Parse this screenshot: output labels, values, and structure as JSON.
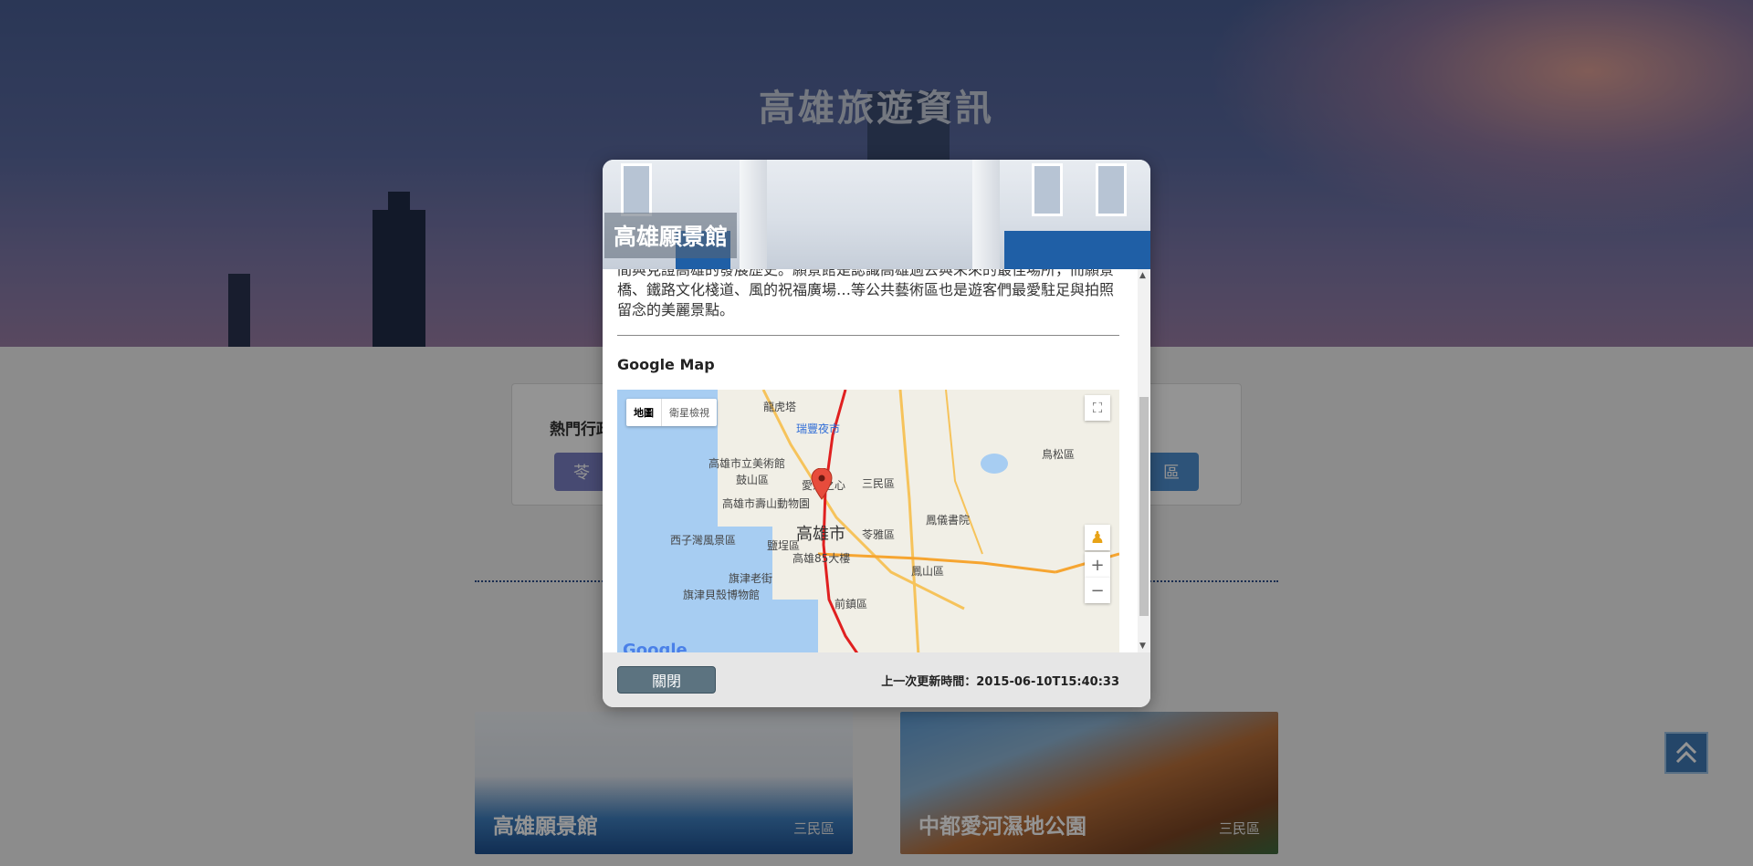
{
  "page": {
    "hero_title": "高雄旅遊資訊",
    "panel_label": "熱門行政區",
    "chip_left": "苓",
    "chip_right": "區"
  },
  "tiles": [
    {
      "title": "高雄願景館",
      "district": "三民區"
    },
    {
      "title": "中都愛河濕地公園",
      "district": "三民區"
    }
  ],
  "modal": {
    "title": "高雄願景館",
    "description": "間與見證高雄的發展歷史。願景館是認識高雄過去與未來的最佳場所，而願景橋、鐵路文化棧道、風的祝福廣場…等公共藝術區也是遊客們最愛駐足與拍照留念的美麗景點。",
    "map_heading": "Google Map",
    "map": {
      "type_map": "地圖",
      "type_satellite": "衛星檢視",
      "fullscreen_icon": "⛶",
      "pegman_icon": "♟",
      "zoom_in": "+",
      "zoom_out": "−",
      "google_logo": "Google",
      "labels": {
        "longhu": "龍虎塔",
        "ruifeng": "瑞豐夜市",
        "museum": "高雄市立美術館",
        "gushan": "鼓山區",
        "zoo": "高雄市壽山動物園",
        "aihe": "愛河之心",
        "sanmin": "三民區",
        "niaosong": "鳥松區",
        "city": "高雄市",
        "lingya": "苓雅區",
        "fengyi": "鳳儀書院",
        "sizihwan": "西子灣風景區",
        "yancheng": "鹽埕區",
        "k85": "高雄85大樓",
        "fengshan": "鳳山區",
        "cijin": "旗津老街",
        "shell": "旗津貝殼博物館",
        "qianzhen": "前鎮區"
      }
    },
    "close_label": "關閉",
    "updated_text": "上一次更新時間：2015-06-10T15:40:33"
  },
  "colors": {
    "close_button": "#5c7380",
    "sea": "#a7cdf2",
    "metro_line": "#e02020",
    "marker": "#e74c3c"
  }
}
